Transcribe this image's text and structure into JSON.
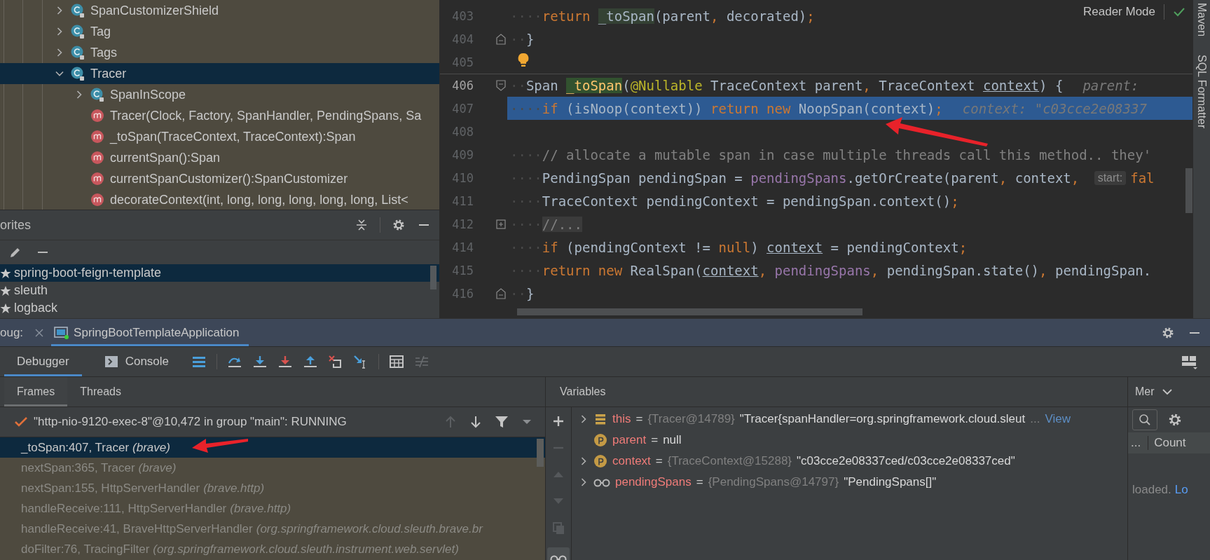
{
  "project_tree": {
    "items": [
      {
        "label": "SpanCustomizerShield",
        "kind": "class",
        "expanded": false,
        "selected": false
      },
      {
        "label": "Tag",
        "kind": "class",
        "expanded": false,
        "selected": false
      },
      {
        "label": "Tags",
        "kind": "class",
        "expanded": false,
        "selected": false
      },
      {
        "label": "Tracer",
        "kind": "class",
        "expanded": true,
        "selected": true,
        "children": [
          {
            "label": "SpanInScope",
            "kind": "class",
            "expanded": false,
            "selected": false
          },
          {
            "label": "Tracer(Clock, Factory, SpanHandler, PendingSpans, Sa",
            "kind": "method",
            "selected": false
          },
          {
            "label": "_toSpan(TraceContext, TraceContext):Span",
            "kind": "method",
            "selected": false
          },
          {
            "label": "currentSpan():Span",
            "kind": "method",
            "selected": false
          },
          {
            "label": "currentSpanCustomizer():SpanCustomizer",
            "kind": "method",
            "selected": false
          },
          {
            "label": "decorateContext(int, long, long, long, long, long, List<",
            "kind": "method",
            "selected": false
          }
        ]
      }
    ]
  },
  "favorites": {
    "title": "orites",
    "items": [
      {
        "label": "spring-boot-feign-template",
        "selected": true
      },
      {
        "label": "sleuth",
        "selected": false
      },
      {
        "label": "logback",
        "selected": false
      }
    ]
  },
  "editor": {
    "reader_mode": "Reader Mode",
    "lines": [
      {
        "number": "403",
        "tokens": [
          {
            "text": "····",
            "kind": "ws"
          },
          {
            "text": "return ",
            "kind": "kw"
          },
          {
            "text": "_toSpan",
            "kind": "usage"
          },
          {
            "text": "(parent",
            "kind": "plain"
          },
          {
            "text": ", ",
            "kind": "kw"
          },
          {
            "text": "decorated)",
            "kind": "plain"
          },
          {
            "text": ";",
            "kind": "kw"
          }
        ]
      },
      {
        "number": "404",
        "gutter": {
          "kind": "fold-end"
        },
        "tokens": [
          {
            "text": "··",
            "kind": "ws"
          },
          {
            "text": "}",
            "kind": "plain"
          }
        ]
      },
      {
        "number": "405",
        "gutter": {
          "kind": "bulb"
        }
      },
      {
        "number": "406",
        "gutter": {
          "kind": "fold-start"
        },
        "caret": true,
        "tokens": [
          {
            "text": "··",
            "kind": "ws"
          },
          {
            "text": "Span ",
            "kind": "plain"
          },
          {
            "text": "_toSpan",
            "kind": "decl"
          },
          {
            "text": "(",
            "kind": "plain"
          },
          {
            "text": "@Nullable",
            "kind": "ann"
          },
          {
            "text": " TraceContext parent",
            "kind": "plain"
          },
          {
            "text": ", ",
            "kind": "kw"
          },
          {
            "text": "TraceContext ",
            "kind": "plain"
          },
          {
            "text": "context",
            "kind": "ul"
          },
          {
            "text": ") {",
            "kind": "plain"
          },
          {
            "text": "parent:",
            "kind": "hint"
          }
        ]
      },
      {
        "number": "407",
        "selected": true,
        "tokens": [
          {
            "text": "····",
            "kind": "ws"
          },
          {
            "text": "if ",
            "kind": "kw"
          },
          {
            "text": "(isNoop(context)) ",
            "kind": "plain"
          },
          {
            "text": "return new ",
            "kind": "kw"
          },
          {
            "text": "NoopSpan(context)",
            "kind": "plain"
          },
          {
            "text": ";",
            "kind": "kw"
          },
          {
            "text": "context: \"c03cce2e08337",
            "kind": "hint"
          }
        ]
      },
      {
        "number": "408"
      },
      {
        "number": "409",
        "tokens": [
          {
            "text": "····",
            "kind": "ws"
          },
          {
            "text": "// allocate a mutable span in case multiple threads call this method.. they'",
            "kind": "comment"
          }
        ]
      },
      {
        "number": "410",
        "tokens": [
          {
            "text": "····",
            "kind": "ws"
          },
          {
            "text": "PendingSpan pendingSpan = ",
            "kind": "plain"
          },
          {
            "text": "pendingSpans",
            "kind": "field"
          },
          {
            "text": ".getOrCreate(parent",
            "kind": "plain"
          },
          {
            "text": ", ",
            "kind": "kw"
          },
          {
            "text": "context",
            "kind": "plain"
          },
          {
            "text": ", ",
            "kind": "kw"
          },
          {
            "text": "start:",
            "kind": "chip"
          },
          {
            "text": "fal",
            "kind": "kw"
          }
        ]
      },
      {
        "number": "411",
        "tokens": [
          {
            "text": "····",
            "kind": "ws"
          },
          {
            "text": "TraceContext pendingContext = pendingSpan.context()",
            "kind": "plain"
          },
          {
            "text": ";",
            "kind": "kw"
          }
        ]
      },
      {
        "number": "412",
        "gutter": {
          "kind": "expand"
        },
        "tokens": [
          {
            "text": "····",
            "kind": "ws"
          },
          {
            "text": "//...",
            "kind": "fold"
          }
        ]
      },
      {
        "number": "414",
        "tokens": [
          {
            "text": "····",
            "kind": "ws"
          },
          {
            "text": "if ",
            "kind": "kw"
          },
          {
            "text": "(pendingContext != ",
            "kind": "plain"
          },
          {
            "text": "null",
            "kind": "kw"
          },
          {
            "text": ") ",
            "kind": "plain"
          },
          {
            "text": "context",
            "kind": "ul"
          },
          {
            "text": " = pendingContext",
            "kind": "plain"
          },
          {
            "text": ";",
            "kind": "kw"
          }
        ]
      },
      {
        "number": "415",
        "tokens": [
          {
            "text": "····",
            "kind": "ws"
          },
          {
            "text": "return new ",
            "kind": "kw"
          },
          {
            "text": "RealSpan(",
            "kind": "plain"
          },
          {
            "text": "context",
            "kind": "ul"
          },
          {
            "text": ", ",
            "kind": "kw"
          },
          {
            "text": "pendingSpans",
            "kind": "field"
          },
          {
            "text": ", ",
            "kind": "kw"
          },
          {
            "text": "pendingSpan.state()",
            "kind": "plain"
          },
          {
            "text": ", ",
            "kind": "kw"
          },
          {
            "text": "pendingSpan.",
            "kind": "plain"
          }
        ]
      },
      {
        "number": "416",
        "gutter": {
          "kind": "fold-end"
        },
        "tokens": [
          {
            "text": "··",
            "kind": "ws"
          },
          {
            "text": "}",
            "kind": "plain"
          }
        ]
      }
    ]
  },
  "side_tabs": [
    "Maven",
    "SQL Formatter"
  ],
  "debug": {
    "label": "oug:",
    "tabs": [
      {
        "label": "SpringBootTemplateApplication",
        "selected": true
      }
    ],
    "view_tabs": [
      {
        "label": "Debugger",
        "kind": "debugger",
        "selected": true
      },
      {
        "label": "Console",
        "kind": "console",
        "selected": false
      }
    ],
    "frames": {
      "tabs": [
        {
          "label": "Frames",
          "selected": true
        },
        {
          "label": "Threads",
          "selected": false
        }
      ],
      "thread": "\"http-nio-9120-exec-8\"@10,472 in group \"main\": RUNNING",
      "items": [
        {
          "method": "_toSpan:407, Tracer",
          "package": "(brave)",
          "selected": true
        },
        {
          "method": "nextSpan:365, Tracer",
          "package": "(brave)",
          "selected": false
        },
        {
          "method": "nextSpan:155, HttpServerHandler",
          "package": "(brave.http)",
          "selected": false
        },
        {
          "method": "handleReceive:111, HttpServerHandler",
          "package": "(brave.http)",
          "selected": false
        },
        {
          "method": "handleReceive:41, BraveHttpServerHandler",
          "package": "(org.springframework.cloud.sleuth.brave.br",
          "selected": false
        },
        {
          "method": "doFilter:76, TracingFilter",
          "package": "(org.springframework.cloud.sleuth.instrument.web.servlet)",
          "selected": false
        }
      ]
    },
    "variables": {
      "title": "Variables",
      "items": [
        {
          "name": "this",
          "kind": "field",
          "expandable": true,
          "operator": "=",
          "type": "{Tracer@14789}",
          "value": "\"Tracer{spanHandler=org.springframework.cloud.sleut",
          "more": "...",
          "link": "View"
        },
        {
          "name": "parent",
          "kind": "param",
          "expandable": false,
          "operator": "=",
          "value": "null"
        },
        {
          "name": "context",
          "kind": "param",
          "expandable": true,
          "operator": "=",
          "type": "{TraceContext@15288}",
          "value": "\"c03cce2e08337ced/c03cce2e08337ced\""
        },
        {
          "name": "pendingSpans",
          "kind": "watch",
          "expandable": true,
          "operator": "=",
          "type": "{PendingSpans@14797}",
          "value": "\"PendingSpans[]\""
        }
      ]
    },
    "memory": {
      "tab": "Mer",
      "column_1": "...",
      "column_2": "Count",
      "message": "loaded.",
      "link": "Lo"
    }
  }
}
